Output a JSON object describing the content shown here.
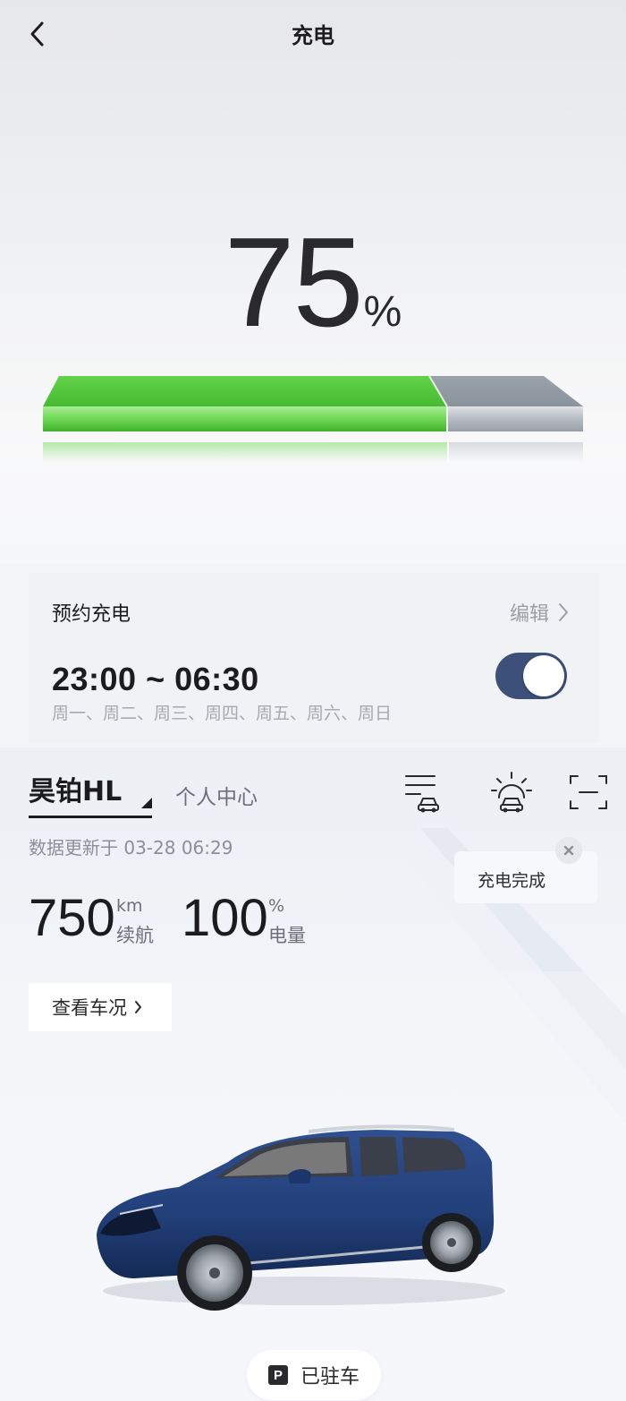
{
  "header": {
    "title": "充电"
  },
  "charge": {
    "percent_value": "75",
    "percent_sign": "%",
    "level": 0.75
  },
  "schedule": {
    "title": "预约充电",
    "edit_label": "编辑",
    "time_range": "23:00 ~ 06:30",
    "days": "周一、周二、周三、周四、周五、周六、周日",
    "enabled": true
  },
  "vehicle": {
    "model_name": "昊铂HL",
    "personal_center": "个人中心",
    "update_text": "数据更新于 03-28 06:29",
    "range_value": "750",
    "range_unit": "km",
    "range_label": "续航",
    "battery_value": "100",
    "battery_unit": "%",
    "battery_label": "电量",
    "check_button": "查看车况",
    "toast_text": "充电完成",
    "parked_badge": "P",
    "parked_label": "已驻车"
  },
  "icons": {
    "back": "chevron-left-icon",
    "car_list": "car-list-icon",
    "car_climate": "car-sun-icon",
    "scan": "scan-icon",
    "close": "close-icon",
    "chevron": "chevron-right-icon"
  },
  "colors": {
    "charge_green": "#52c63a",
    "remaining_gray": "#a8aeb6",
    "toggle_on": "#3c5079"
  }
}
